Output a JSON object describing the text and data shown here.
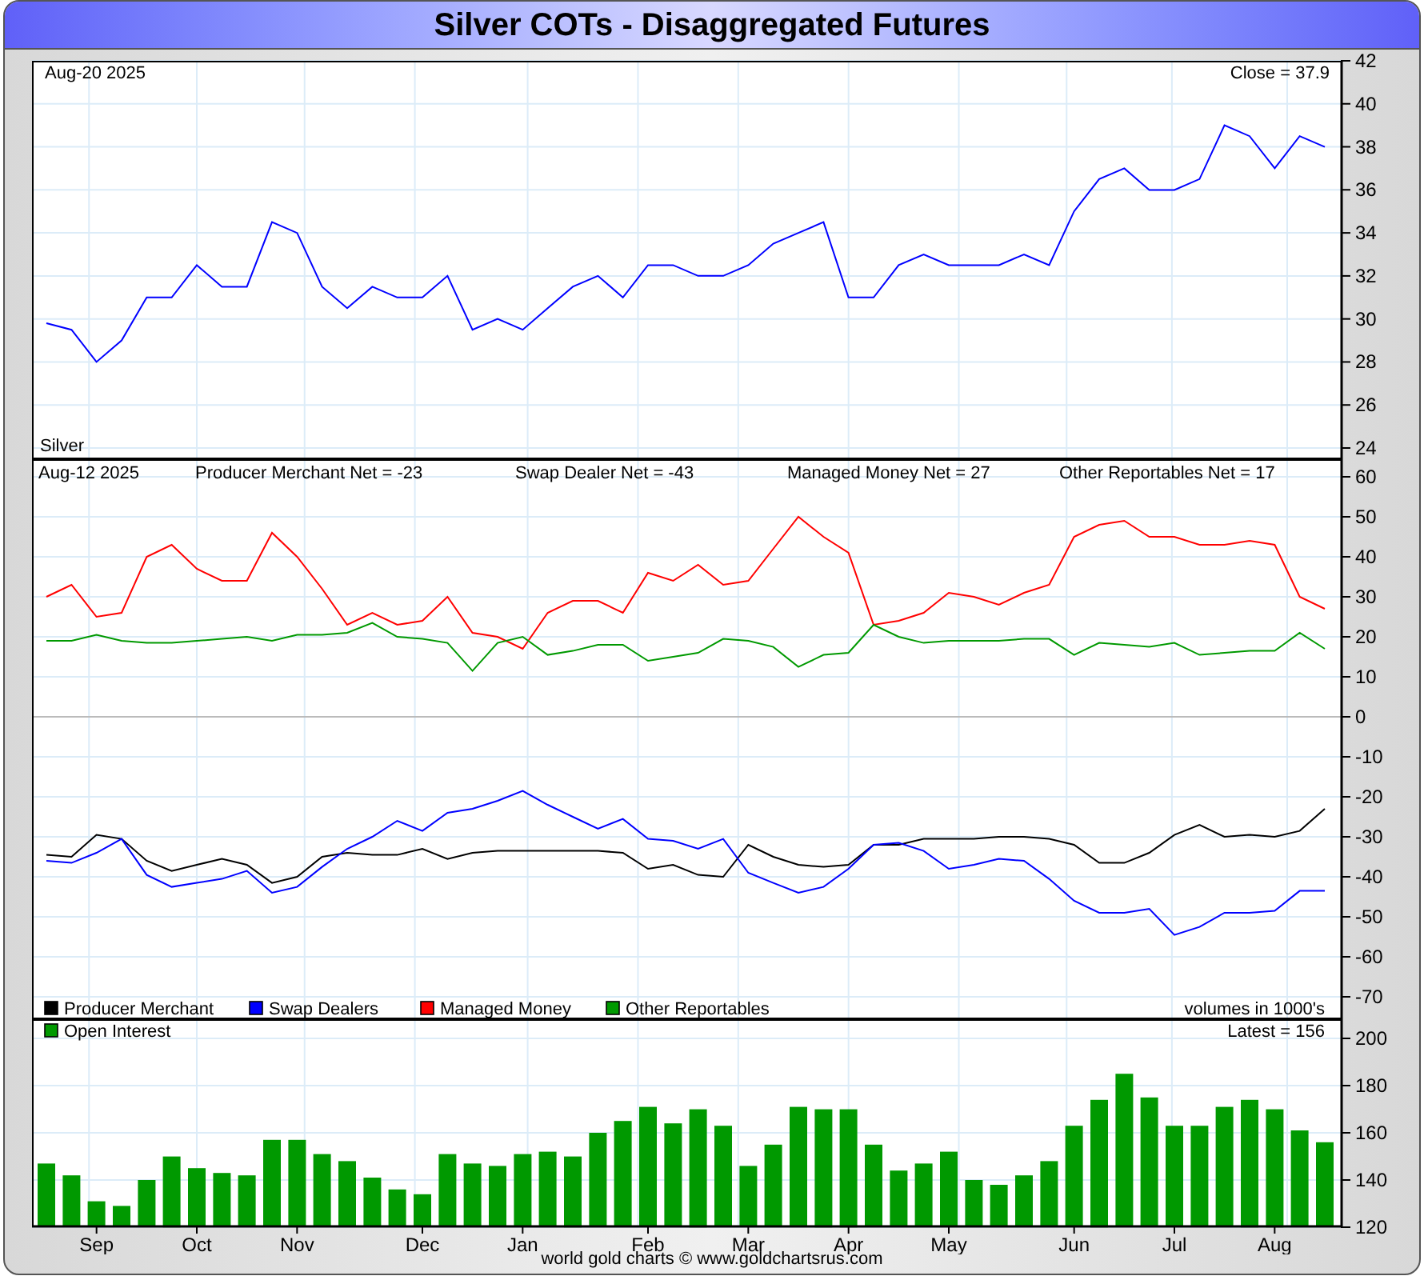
{
  "title": "Silver COTs - Disaggregated Futures",
  "price_panel": {
    "date": "Aug-20  2025",
    "close_label": "Close = 37.9",
    "chart_data": {
      "type": "line",
      "grid": true,
      "ylim": [
        24,
        42
      ],
      "yticks": [
        24,
        26,
        28,
        30,
        32,
        34,
        36,
        38,
        40,
        42
      ],
      "categories": [
        null,
        null,
        null,
        null,
        null,
        null,
        null,
        null,
        null,
        null,
        null,
        null,
        null,
        null,
        null,
        null,
        null,
        null,
        null,
        null,
        null,
        null,
        null,
        null,
        null,
        null,
        null,
        null,
        null,
        null,
        null,
        null,
        null,
        null,
        null,
        null,
        null,
        null,
        null,
        null,
        null,
        null,
        null,
        null,
        null,
        null,
        null,
        null,
        null,
        null,
        null,
        null
      ],
      "series": [
        {
          "name": "Silver",
          "color": "#0000ff",
          "values": [
            29.8,
            29.5,
            28,
            29,
            31,
            31,
            32.5,
            31.5,
            31.5,
            34.5,
            34,
            31.5,
            30.5,
            31.5,
            31,
            31,
            32,
            29.5,
            30,
            29.5,
            30.5,
            31.5,
            32,
            31,
            32.5,
            32.5,
            32,
            32,
            32.5,
            33.5,
            34,
            34.5,
            31,
            31,
            32.5,
            33,
            32.5,
            32.5,
            32.5,
            33,
            32.5,
            35,
            36.5,
            37,
            36,
            36,
            36.5,
            39,
            38.5,
            37,
            38.5,
            38
          ]
        }
      ]
    }
  },
  "cot_panel": {
    "date": "Aug-12  2025",
    "net_labels": [
      "Producer Merchant Net = -23",
      "Swap Dealer Net = -43",
      "Managed Money Net = 27",
      "Other Reportables Net = 17"
    ],
    "volumes_note": "volumes in 1000's",
    "chart_data": {
      "type": "line",
      "grid": true,
      "legend": true,
      "ylim": [
        -70,
        60
      ],
      "yticks": [
        -70,
        -60,
        -50,
        -40,
        -30,
        -20,
        -10,
        0,
        10,
        20,
        30,
        40,
        50,
        60
      ],
      "categories": [
        null,
        null,
        null,
        null,
        null,
        null,
        null,
        null,
        null,
        null,
        null,
        null,
        null,
        null,
        null,
        null,
        null,
        null,
        null,
        null,
        null,
        null,
        null,
        null,
        null,
        null,
        null,
        null,
        null,
        null,
        null,
        null,
        null,
        null,
        null,
        null,
        null,
        null,
        null,
        null,
        null,
        null,
        null,
        null,
        null,
        null,
        null,
        null,
        null,
        null,
        null,
        null
      ],
      "series": [
        {
          "name": "Producer Merchant",
          "color": "#000000",
          "values": [
            -34.5,
            -35,
            -29.5,
            -30.5,
            -36,
            -38.5,
            -37,
            -35.5,
            -37,
            -41.5,
            -40,
            -35,
            -34,
            -34.5,
            -34.5,
            -33,
            -35.5,
            -34,
            -33.5,
            -33.5,
            -33.5,
            -33.5,
            -33.5,
            -34,
            -38,
            -37,
            -39.5,
            -40,
            -32,
            -35,
            -37,
            -37.5,
            -37,
            -32,
            -32,
            -30.5,
            -30.5,
            -30.5,
            -30,
            -30,
            -30.5,
            -32,
            -36.5,
            -36.5,
            -34,
            -29.5,
            -27,
            -30,
            -29.5,
            -30,
            -28.5,
            -23
          ]
        },
        {
          "name": "Swap Dealers",
          "color": "#0000ff",
          "values": [
            -36,
            -36.5,
            -34,
            -30.5,
            -39.5,
            -42.5,
            -41.5,
            -40.5,
            -38.5,
            -44,
            -42.5,
            -37.5,
            -33,
            -30,
            -26,
            -28.5,
            -24,
            -23,
            -21,
            -18.5,
            -22,
            -25,
            -28,
            -25.5,
            -30.5,
            -31,
            -33,
            -30.5,
            -39,
            -41.5,
            -44,
            -42.5,
            -38,
            -32,
            -31.5,
            -33.5,
            -38,
            -37,
            -35.5,
            -36,
            -40.5,
            -46,
            -49,
            -49,
            -48,
            -54.5,
            -52.5,
            -49,
            -49,
            -48.5,
            -43.5,
            -43.5
          ]
        },
        {
          "name": "Managed Money",
          "color": "#ff0000",
          "values": [
            30,
            33,
            25,
            26,
            40,
            43,
            37,
            34,
            34,
            46,
            40,
            32,
            23,
            26,
            23,
            24,
            30,
            21,
            20,
            17,
            26,
            29,
            29,
            26,
            36,
            34,
            38,
            33,
            34,
            42,
            50,
            45,
            41,
            23,
            24,
            26,
            31,
            30,
            28,
            31,
            33,
            45,
            48,
            49,
            45,
            45,
            43,
            43,
            44,
            43,
            30,
            27
          ]
        },
        {
          "name": "Other Reportables",
          "color": "#009900",
          "values": [
            19,
            19,
            20.5,
            19,
            18.5,
            18.5,
            19,
            19.5,
            20,
            19,
            20.5,
            20.5,
            21,
            23.5,
            20,
            19.5,
            18.5,
            11.5,
            18.5,
            20,
            15.5,
            16.5,
            18,
            18,
            14,
            15,
            16,
            19.5,
            19,
            17.5,
            12.5,
            15.5,
            16,
            23,
            20,
            18.5,
            19,
            19,
            19,
            19.5,
            19.5,
            15.5,
            18.5,
            18,
            17.5,
            18.5,
            15.5,
            16,
            16.5,
            16.5,
            21,
            17
          ]
        }
      ]
    }
  },
  "oi_panel": {
    "latest_label": "Latest = 156",
    "chart_data": {
      "type": "bar",
      "grid": true,
      "legend": true,
      "ylim": [
        120,
        200
      ],
      "yticks": [
        120,
        140,
        160,
        180,
        200
      ],
      "categories": [
        null,
        null,
        "Sep",
        null,
        null,
        null,
        "Oct",
        null,
        null,
        null,
        "Nov",
        null,
        null,
        null,
        null,
        "Dec",
        null,
        null,
        null,
        "Jan",
        null,
        null,
        null,
        null,
        "Feb",
        null,
        null,
        null,
        "Mar",
        null,
        null,
        null,
        "Apr",
        null,
        null,
        null,
        "May",
        null,
        null,
        null,
        null,
        "Jun",
        null,
        null,
        null,
        "Jul",
        null,
        null,
        null,
        "Aug",
        null,
        null
      ],
      "series": [
        {
          "name": "Open Interest",
          "color": "#009900",
          "values": [
            147,
            142,
            131,
            129,
            140,
            150,
            145,
            143,
            142,
            157,
            157,
            151,
            148,
            141,
            136,
            134,
            151,
            147,
            146,
            151,
            152,
            150,
            160,
            165,
            171,
            164,
            170,
            163,
            146,
            155,
            171,
            170,
            170,
            155,
            144,
            147,
            152,
            140,
            138,
            142,
            148,
            163,
            174,
            185,
            175,
            163,
            163,
            171,
            174,
            170,
            161,
            156
          ]
        }
      ]
    }
  },
  "footer": "world gold charts © www.goldchartsrus.com"
}
